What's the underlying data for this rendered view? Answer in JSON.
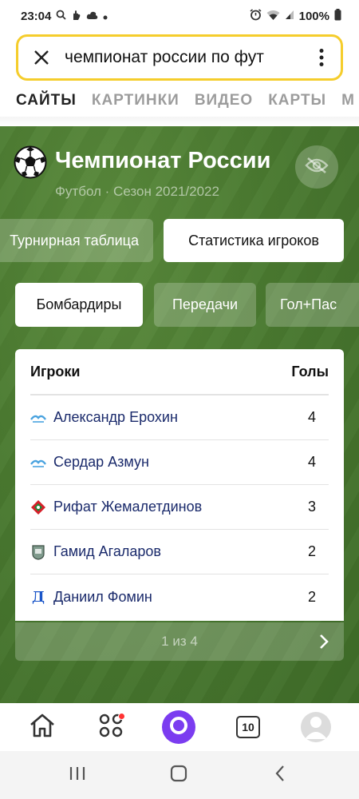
{
  "status_bar": {
    "time": "23:04",
    "battery": "100%"
  },
  "search": {
    "query": "чемпионат россии по фут"
  },
  "tabs": [
    {
      "label": "САЙТЫ",
      "active": true
    },
    {
      "label": "КАРТИНКИ",
      "active": false
    },
    {
      "label": "ВИДЕО",
      "active": false
    },
    {
      "label": "КАРТЫ",
      "active": false
    },
    {
      "label": "М",
      "active": false
    }
  ],
  "card": {
    "title": "Чемпионат России",
    "subtitle": "Футбол · Сезон 2021/2022",
    "main_tabs": [
      {
        "label": "Турнирная таблица",
        "active": false
      },
      {
        "label": "Статистика игроков",
        "active": true
      }
    ],
    "stat_tabs": [
      {
        "label": "Бомбардиры",
        "active": true
      },
      {
        "label": "Передачи",
        "active": false
      },
      {
        "label": "Гол+Пас",
        "active": false
      }
    ],
    "table": {
      "col_players": "Игроки",
      "col_goals": "Голы",
      "rows": [
        {
          "player": "Александр Ерохин",
          "goals": "4",
          "club_icon": "zenit-logo-icon"
        },
        {
          "player": "Сердар Азмун",
          "goals": "4",
          "club_icon": "zenit-logo-icon"
        },
        {
          "player": "Рифат Жемалетдинов",
          "goals": "3",
          "club_icon": "lokomotiv-logo-icon"
        },
        {
          "player": "Гамид Агаларов",
          "goals": "2",
          "club_icon": "ufa-logo-icon"
        },
        {
          "player": "Даниил Фомин",
          "goals": "2",
          "club_icon": "dynamo-logo-icon"
        }
      ]
    },
    "pager": "1 из 4"
  },
  "bottom_nav": {
    "tabs_count": "10"
  },
  "colors": {
    "search_border": "#f5cd2c",
    "card_green": "#4a7a30",
    "alice_purple": "#7b3cf0",
    "player_link": "#1a2a6b"
  }
}
